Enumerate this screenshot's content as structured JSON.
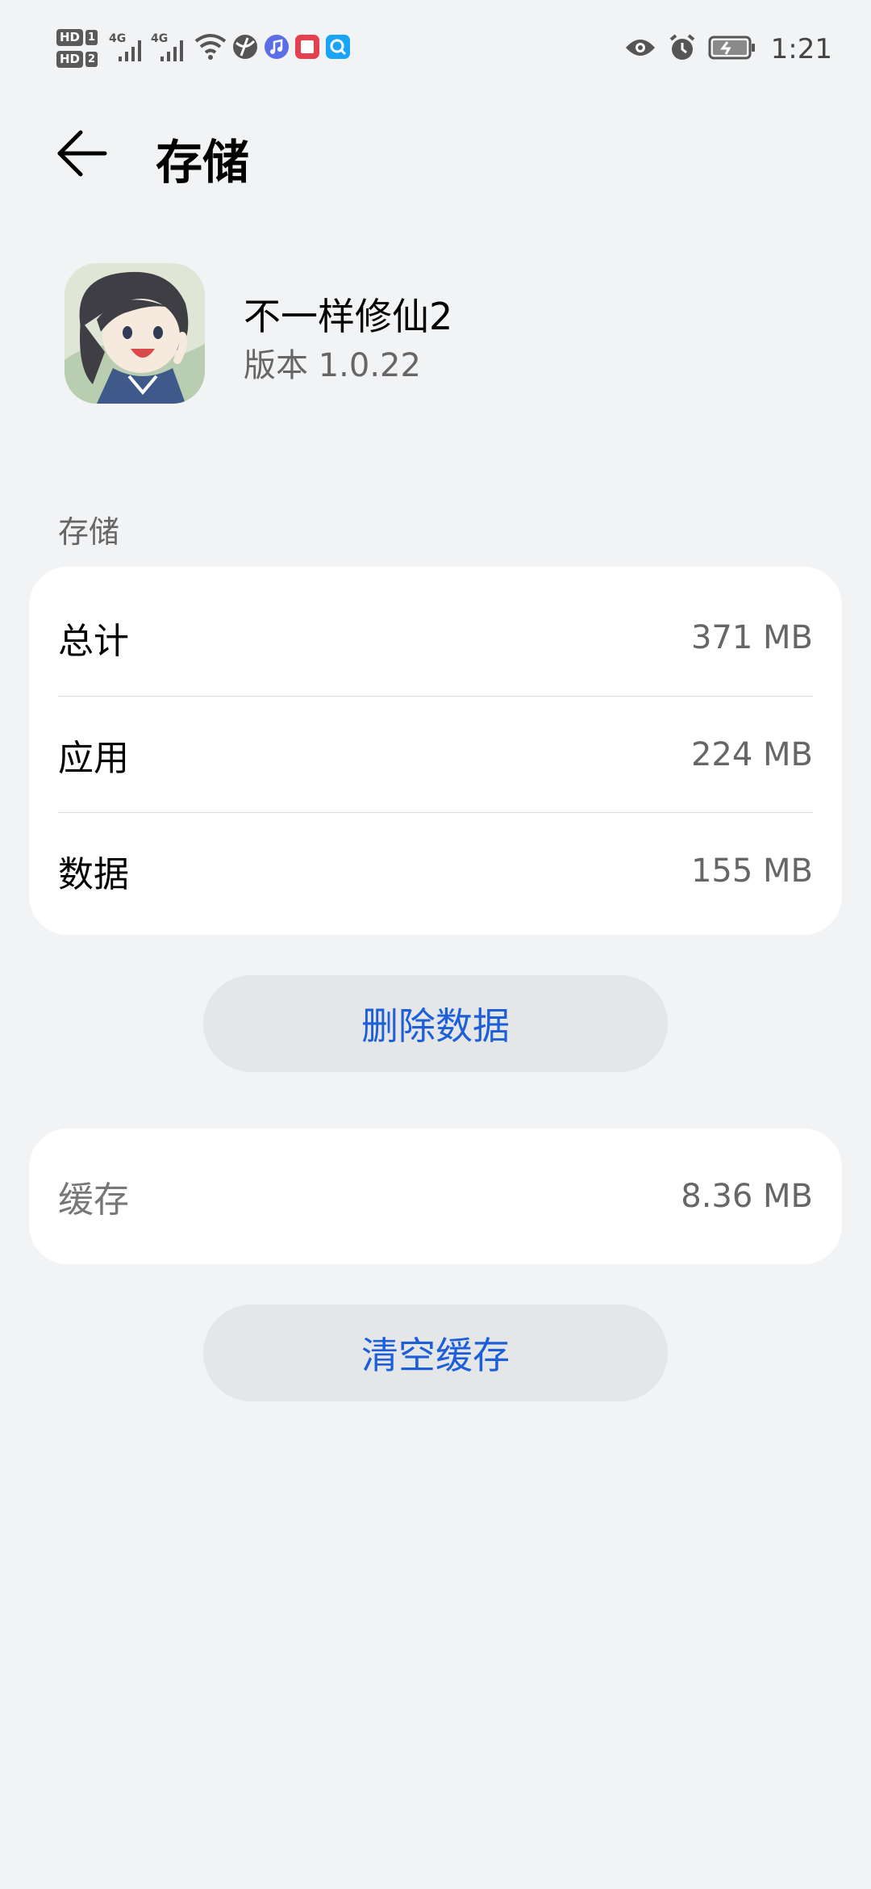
{
  "status_bar": {
    "sim1_label": "HD",
    "sim1_num": "1",
    "sim2_label": "HD",
    "sim2_num": "2",
    "network1": "4G",
    "network2": "4G",
    "time": "1:21",
    "icons": [
      "signal-icon",
      "wifi-icon",
      "vpn-icon",
      "music-icon",
      "book-icon",
      "search-app-icon",
      "eye-icon",
      "alarm-icon",
      "battery-icon"
    ]
  },
  "header": {
    "title": "存储"
  },
  "app": {
    "name": "不一样修仙2",
    "version": "版本 1.0.22"
  },
  "storage": {
    "section_label": "存储",
    "rows": [
      {
        "label": "总计",
        "value": "371 MB"
      },
      {
        "label": "应用",
        "value": "224 MB"
      },
      {
        "label": "数据",
        "value": "155 MB"
      }
    ],
    "delete_button": "删除数据"
  },
  "cache": {
    "label": "缓存",
    "value": "8.36 MB",
    "clear_button": "清空缓存"
  },
  "colors": {
    "background": "#f1f3f5",
    "card": "#ffffff",
    "accent": "#1c5fd9",
    "button_bg": "#e4e6e8"
  }
}
